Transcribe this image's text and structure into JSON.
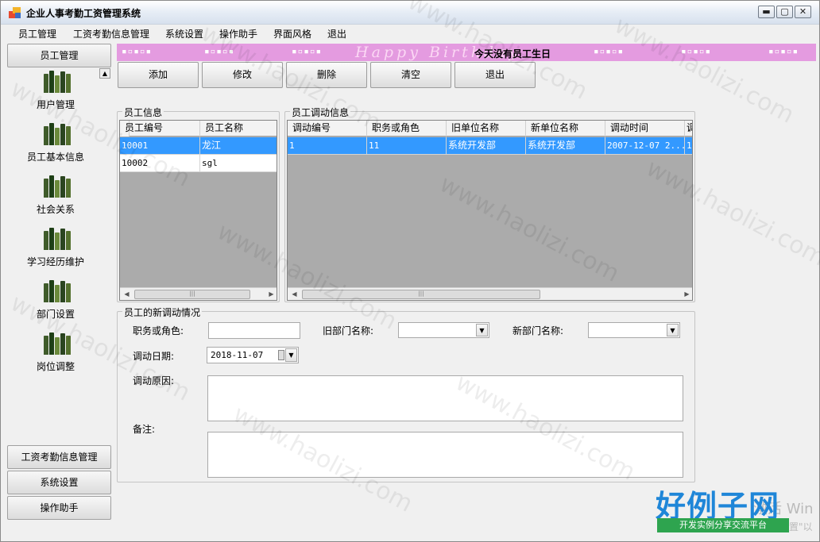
{
  "window": {
    "title": "企业人事考勤工资管理系统",
    "controls": {
      "minimize": "▬",
      "maximize": "▢",
      "close": "✕"
    }
  },
  "menu": [
    "员工管理",
    "工资考勤信息管理",
    "系统设置",
    "操作助手",
    "界面风格",
    "退出"
  ],
  "sidebar": {
    "header": "员工管理",
    "items": [
      "用户管理",
      "员工基本信息",
      "社会关系",
      "学习经历维护",
      "部门设置",
      "岗位调整"
    ],
    "footer_buttons": [
      "工资考勤信息管理",
      "系统设置",
      "操作助手"
    ],
    "scroll_up": "▲"
  },
  "banner": {
    "script_text": "Happy Birthday",
    "message": "今天没有员工生日",
    "confetti": "▪▫▪▫▪",
    "color": "#e49be0"
  },
  "toolbar": {
    "add": "添加",
    "edit": "修改",
    "delete": "删除",
    "clear": "清空",
    "exit": "退出"
  },
  "employees": {
    "title": "员工信息",
    "columns": [
      "员工编号",
      "员工名称"
    ],
    "rows": [
      {
        "id": "10001",
        "name": "龙江",
        "selected": true
      },
      {
        "id": "10002",
        "name": "sgl",
        "selected": false
      }
    ]
  },
  "transfers": {
    "title": "员工调动信息",
    "columns": [
      "调动编号",
      "职务或角色",
      "旧单位名称",
      "新单位名称",
      "调动时间",
      "调"
    ],
    "rows": [
      {
        "no": "1",
        "role": "11",
        "old_unit": "系统开发部",
        "new_unit": "系统开发部",
        "time": "2007-12-07 2...",
        "extra": "1",
        "selected": true
      }
    ]
  },
  "new_transfer": {
    "title": "员工的新调动情况",
    "role_label": "职务或角色:",
    "role_value": "",
    "old_dept_label": "旧部门名称:",
    "old_dept_value": "",
    "new_dept_label": "新部门名称:",
    "new_dept_value": "",
    "date_label": "调动日期:",
    "date_value": "2018-11-07",
    "reason_label": "调动原因:",
    "reason_value": "",
    "note_label": "备注:",
    "note_value": ""
  },
  "watermark": "www.haolizi.com",
  "logo": {
    "big": "好例子网",
    "strip": "开发实例分享交流平台"
  },
  "activation": {
    "text": "激活 Win",
    "sub": "置\"以"
  },
  "scroll_glyphs": {
    "left": "◀",
    "right": "▶",
    "thumb": "|||",
    "dropdown": "▼"
  }
}
